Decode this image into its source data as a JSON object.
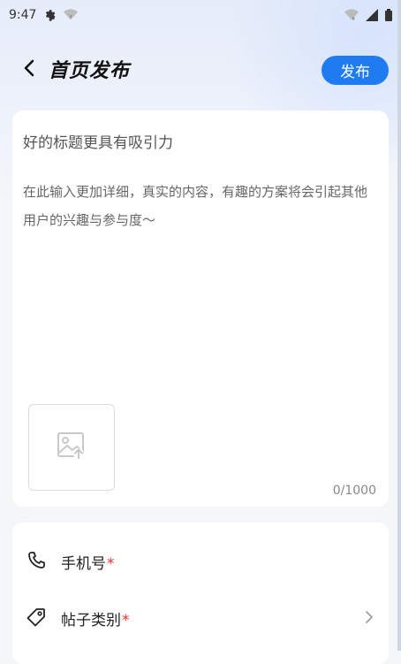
{
  "status_bar": {
    "time": "9:47"
  },
  "header": {
    "title": "首页发布",
    "publish_label": "发布"
  },
  "editor": {
    "title_placeholder": "好的标题更具有吸引力",
    "title_value": "",
    "content_placeholder": "在此输入更加详细，真实的内容，有趣的方案将会引起其他用户的兴趣与参与度～",
    "content_value": "",
    "char_count": "0/1000"
  },
  "info": {
    "phone_label": "手机号",
    "category_label": "帖子类别",
    "required_mark": "*"
  },
  "icons": {
    "back": "chevron-left-icon",
    "settings": "gear-icon",
    "wifi": "wifi-icon",
    "signal": "signal-icon",
    "battery": "battery-icon",
    "image_upload": "image-upload-icon",
    "phone": "phone-icon",
    "tag": "tag-icon",
    "arrow": "chevron-right-icon"
  },
  "colors": {
    "accent": "#1f7cf0",
    "required": "#e33333",
    "background": "#f5f6f8",
    "card": "#ffffff"
  }
}
